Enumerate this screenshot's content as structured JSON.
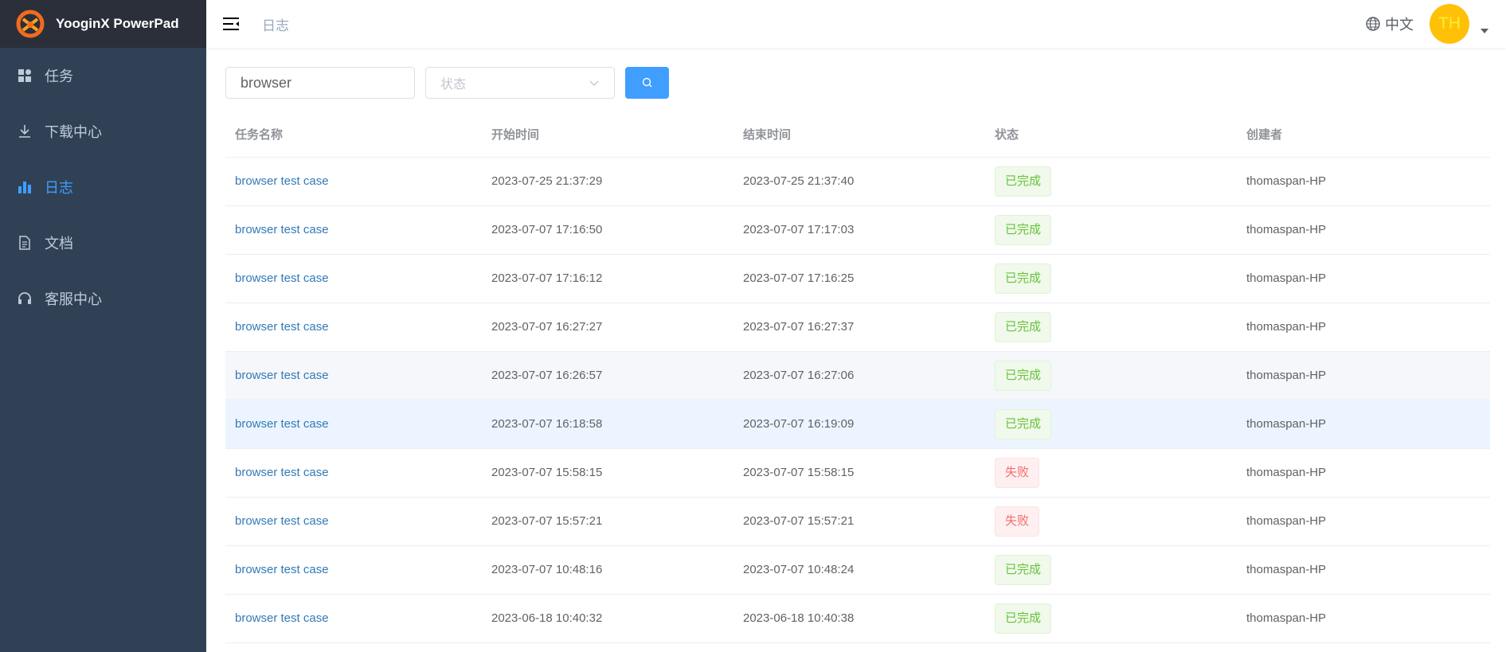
{
  "app": {
    "title": "YooginX PowerPad"
  },
  "sidebar": {
    "items": [
      {
        "label": "任务",
        "icon": "dashboard-icon"
      },
      {
        "label": "下载中心",
        "icon": "download-icon"
      },
      {
        "label": "日志",
        "icon": "bar-chart-icon",
        "active": true
      },
      {
        "label": "文档",
        "icon": "document-icon"
      },
      {
        "label": "客服中心",
        "icon": "headset-icon"
      }
    ]
  },
  "header": {
    "breadcrumb": "日志",
    "language": "中文",
    "avatar_initials": "TH"
  },
  "filters": {
    "search_value": "browser",
    "status_placeholder": "状态"
  },
  "colors": {
    "accent": "#409eff",
    "sidebar": "#304156",
    "success": "#67c23a",
    "danger": "#f56c6c",
    "avatar": "#ffc107"
  },
  "table": {
    "columns": [
      "任务名称",
      "开始时间",
      "结束时间",
      "状态",
      "创建者"
    ],
    "rows": [
      [
        "browser test case",
        "2023-07-25 21:37:29",
        "2023-07-25 21:37:40",
        "已完成",
        "thomaspan-HP"
      ],
      [
        "browser test case",
        "2023-07-07 17:16:50",
        "2023-07-07 17:17:03",
        "已完成",
        "thomaspan-HP"
      ],
      [
        "browser test case",
        "2023-07-07 17:16:12",
        "2023-07-07 17:16:25",
        "已完成",
        "thomaspan-HP"
      ],
      [
        "browser test case",
        "2023-07-07 16:27:27",
        "2023-07-07 16:27:37",
        "已完成",
        "thomaspan-HP"
      ],
      [
        "browser test case",
        "2023-07-07 16:26:57",
        "2023-07-07 16:27:06",
        "已完成",
        "thomaspan-HP"
      ],
      [
        "browser test case",
        "2023-07-07 16:18:58",
        "2023-07-07 16:19:09",
        "已完成",
        "thomaspan-HP"
      ],
      [
        "browser test case",
        "2023-07-07 15:58:15",
        "2023-07-07 15:58:15",
        "失败",
        "thomaspan-HP"
      ],
      [
        "browser test case",
        "2023-07-07 15:57:21",
        "2023-07-07 15:57:21",
        "失败",
        "thomaspan-HP"
      ],
      [
        "browser test case",
        "2023-07-07 10:48:16",
        "2023-07-07 10:48:24",
        "已完成",
        "thomaspan-HP"
      ],
      [
        "browser test case",
        "2023-06-18 10:40:32",
        "2023-06-18 10:40:38",
        "已完成",
        "thomaspan-HP"
      ]
    ]
  }
}
